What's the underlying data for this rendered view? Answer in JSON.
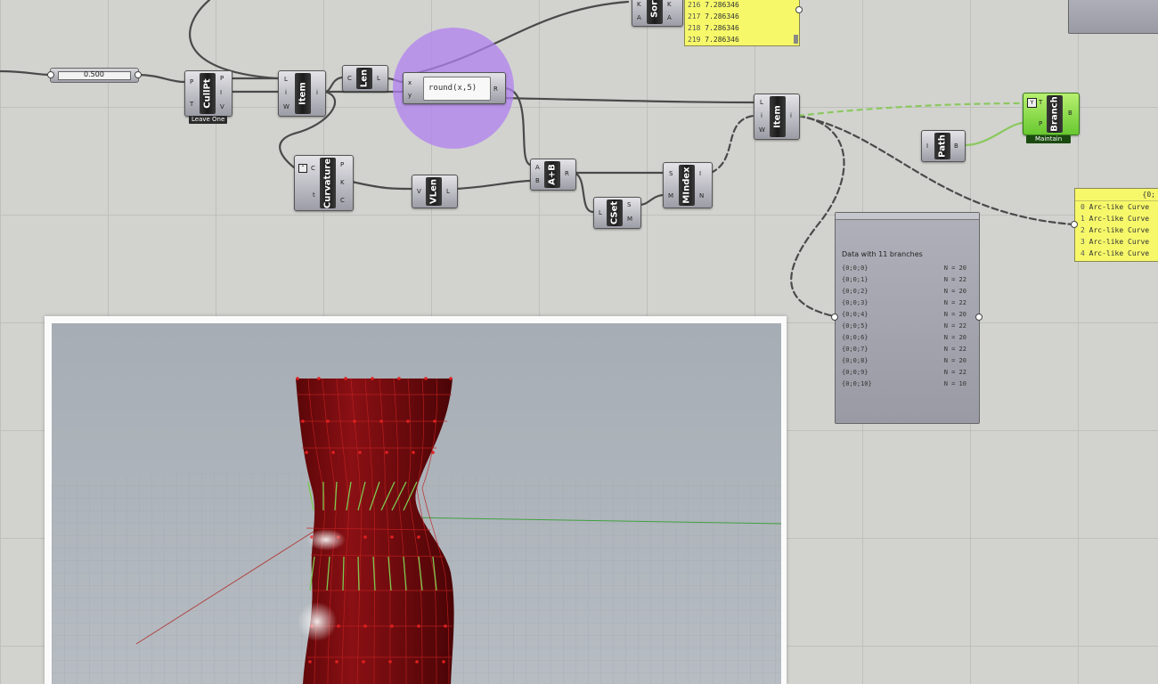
{
  "slider": {
    "value": "0.500"
  },
  "components": {
    "cullpt": {
      "name": "CullPt",
      "inputs": [
        "P",
        "T"
      ],
      "outputs": [
        "P",
        "I",
        "V"
      ],
      "tag": "Leave One"
    },
    "item1": {
      "name": "Item",
      "inputs": [
        "L",
        "i",
        "W"
      ],
      "outputs": [
        "i"
      ]
    },
    "len": {
      "name": "Len",
      "inputs": [
        "C"
      ],
      "outputs": [
        "L"
      ]
    },
    "expr": {
      "text": "round(x,5)",
      "inputs": [
        "x",
        "y"
      ],
      "outputs": [
        "R"
      ]
    },
    "sort": {
      "name": "Sort",
      "inputs": [
        "K",
        "A"
      ],
      "outputs": [
        "K",
        "A"
      ]
    },
    "curvature": {
      "name": "Curvature",
      "inputs": [
        "C",
        "t"
      ],
      "outputs": [
        "P",
        "K",
        "C"
      ]
    },
    "vlen": {
      "name": "VLen",
      "inputs": [
        "V"
      ],
      "outputs": [
        "L"
      ]
    },
    "aplusb": {
      "name": "A+B",
      "inputs": [
        "A",
        "B"
      ],
      "outputs": [
        "R"
      ]
    },
    "cset": {
      "name": "CSet",
      "inputs": [
        "L"
      ],
      "outputs": [
        "S",
        "M"
      ]
    },
    "mindex": {
      "name": "MIndex",
      "inputs": [
        "S",
        "M"
      ],
      "outputs": [
        "I",
        "N"
      ]
    },
    "item2": {
      "name": "Item",
      "inputs": [
        "L",
        "i",
        "W"
      ],
      "outputs": [
        "i"
      ]
    },
    "path": {
      "name": "Path",
      "inputs": [
        "I"
      ],
      "outputs": [
        "B"
      ]
    },
    "branch": {
      "name": "Branch",
      "inputs": [
        "T",
        "P"
      ],
      "outputs": [
        "B"
      ],
      "tag": "Maintain"
    }
  },
  "sort_panel": {
    "rows": [
      {
        "index": "216",
        "value": "7.286346"
      },
      {
        "index": "217",
        "value": "7.286346"
      },
      {
        "index": "218",
        "value": "7.286346"
      },
      {
        "index": "219",
        "value": "7.286346"
      }
    ]
  },
  "curve_panel": {
    "header": "{0;",
    "rows": [
      {
        "index": "0",
        "value": "Arc-like Curve"
      },
      {
        "index": "1",
        "value": "Arc-like Curve"
      },
      {
        "index": "2",
        "value": "Arc-like Curve"
      },
      {
        "index": "3",
        "value": "Arc-like Curve"
      },
      {
        "index": "4",
        "value": "Arc-like Curve"
      }
    ]
  },
  "data_panel": {
    "title": "Data with 11 branches",
    "branches": [
      {
        "path": "{0;0;0}",
        "count": "N = 20"
      },
      {
        "path": "{0;0;1}",
        "count": "N = 22"
      },
      {
        "path": "{0;0;2}",
        "count": "N = 20"
      },
      {
        "path": "{0;0;3}",
        "count": "N = 22"
      },
      {
        "path": "{0;0;4}",
        "count": "N = 20"
      },
      {
        "path": "{0;0;5}",
        "count": "N = 22"
      },
      {
        "path": "{0;0;6}",
        "count": "N = 20"
      },
      {
        "path": "{0;0;7}",
        "count": "N = 22"
      },
      {
        "path": "{0;0;8}",
        "count": "N = 20"
      },
      {
        "path": "{0;0;9}",
        "count": "N = 22"
      },
      {
        "path": "{0;0;10}",
        "count": "N = 10"
      }
    ]
  },
  "colors": {
    "surface": "#7a0d10",
    "accent_green": "#7ec850",
    "selection": "#b080f0"
  }
}
